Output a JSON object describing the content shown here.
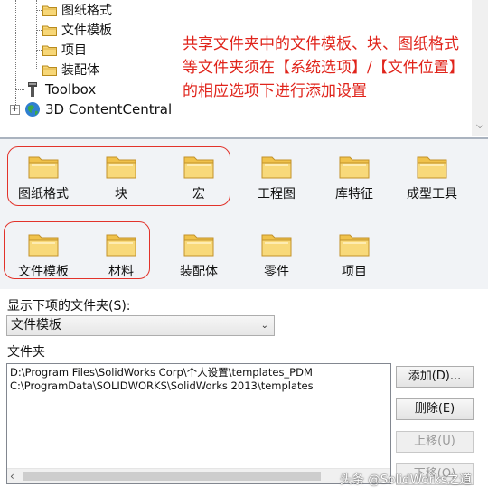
{
  "tree": {
    "items": [
      {
        "label": "图纸格式",
        "icon": "folder-icon"
      },
      {
        "label": "文件模板",
        "icon": "folder-icon"
      },
      {
        "label": "项目",
        "icon": "folder-icon"
      },
      {
        "label": "装配体",
        "icon": "folder-icon"
      },
      {
        "label": "Toolbox",
        "icon": "toolbox-icon"
      },
      {
        "label": "3D ContentCentral",
        "icon": "globe-icon"
      }
    ],
    "expander": "+"
  },
  "annotation": "共享文件夹中的文件模板、块、图纸格式等文件夹须在【系统选项】/【文件位置】的相应选项下进行添加设置",
  "grid": {
    "row1": [
      "图纸格式",
      "块",
      "宏",
      "工程图",
      "库特征",
      "成型工具"
    ],
    "row2": [
      "文件模板",
      "材料",
      "装配体",
      "零件",
      "项目"
    ]
  },
  "form": {
    "show_label": "显示下项的文件夹(S):",
    "selected_folder": "文件模板",
    "folders_label": "文件夹",
    "paths": [
      "D:\\Program Files\\SolidWorks Corp\\个人设置\\templates_PDM",
      "C:\\ProgramData\\SOLIDWORKS\\SolidWorks 2013\\templates"
    ]
  },
  "buttons": {
    "add": "添加(D)...",
    "delete": "删除(E)",
    "up": "上移(U)",
    "down": "下移(O)"
  },
  "watermark": "头条 @SolidWorks之道",
  "colors": {
    "annotation": "#e0241b",
    "highlight": "#e2322a",
    "folder": "#f2c94c"
  }
}
